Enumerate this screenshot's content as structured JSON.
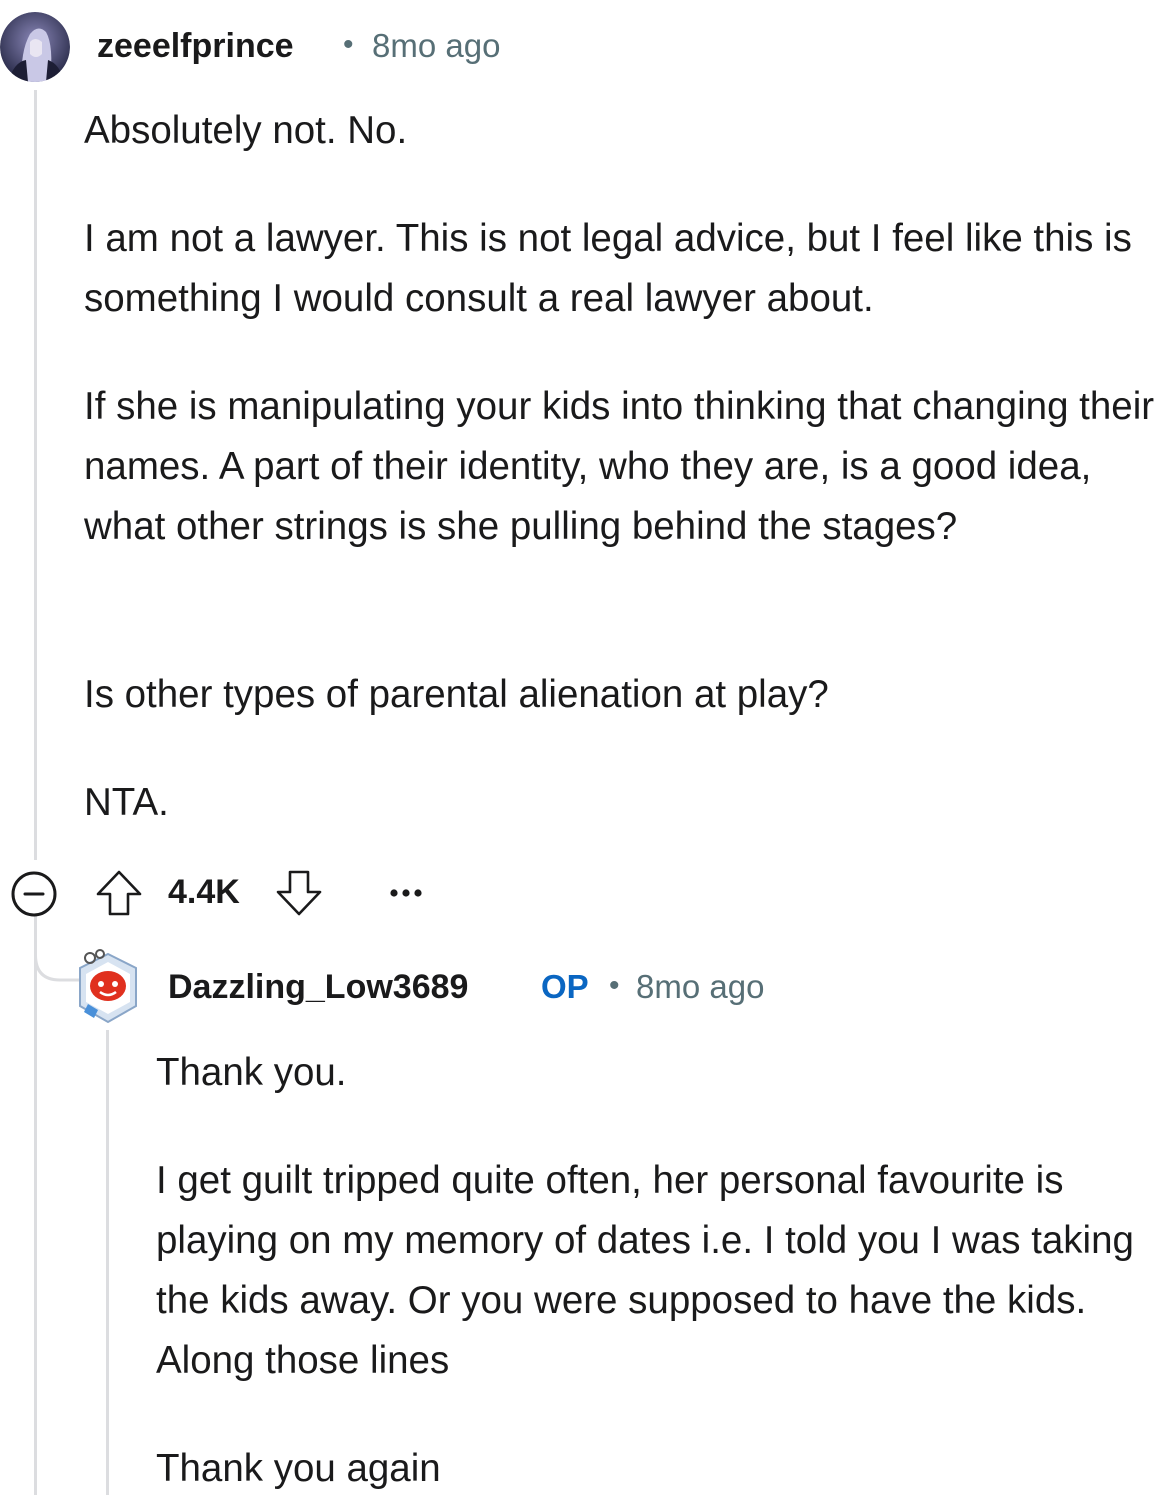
{
  "comment": {
    "username": "zeeelfprince",
    "separator": "•",
    "timestamp": "8mo ago",
    "avatar_icon": "user-avatar-icon",
    "paragraphs": [
      "Absolutely not. No.",
      "I am not a lawyer. This is not legal advice, but I feel like this is something I would consult a real lawyer about.",
      "If she is manipulating your kids into thinking that changing their names. A part of their identity, who they are, is a good idea, what other strings is she pulling behind the stages?",
      "Is other types of parental alienation at play?",
      "NTA."
    ],
    "actions": {
      "collapse_icon": "collapse-minus-icon",
      "upvote_icon": "upvote-arrow-icon",
      "score": "4.4K",
      "downvote_icon": "downvote-arrow-icon",
      "more_icon": "more-options-icon",
      "more_label": "•••"
    }
  },
  "reply": {
    "username": "Dazzling_Low3689",
    "op_badge": "OP",
    "separator": "•",
    "timestamp": "8mo ago",
    "avatar_icon": "snoo-avatar-icon",
    "paragraphs": [
      "Thank you.",
      "I get guilt tripped quite often, her personal favourite is playing on my memory of dates i.e. I told you I was taking the kids away. Or you were supposed to have the kids. Along those lines",
      "Thank you again"
    ]
  },
  "colors": {
    "text": "#1a1a1b",
    "meta": "#576f76",
    "op": "#0a66c2",
    "thread_line": "#dcdde0",
    "icon": "#1a1a1b"
  }
}
